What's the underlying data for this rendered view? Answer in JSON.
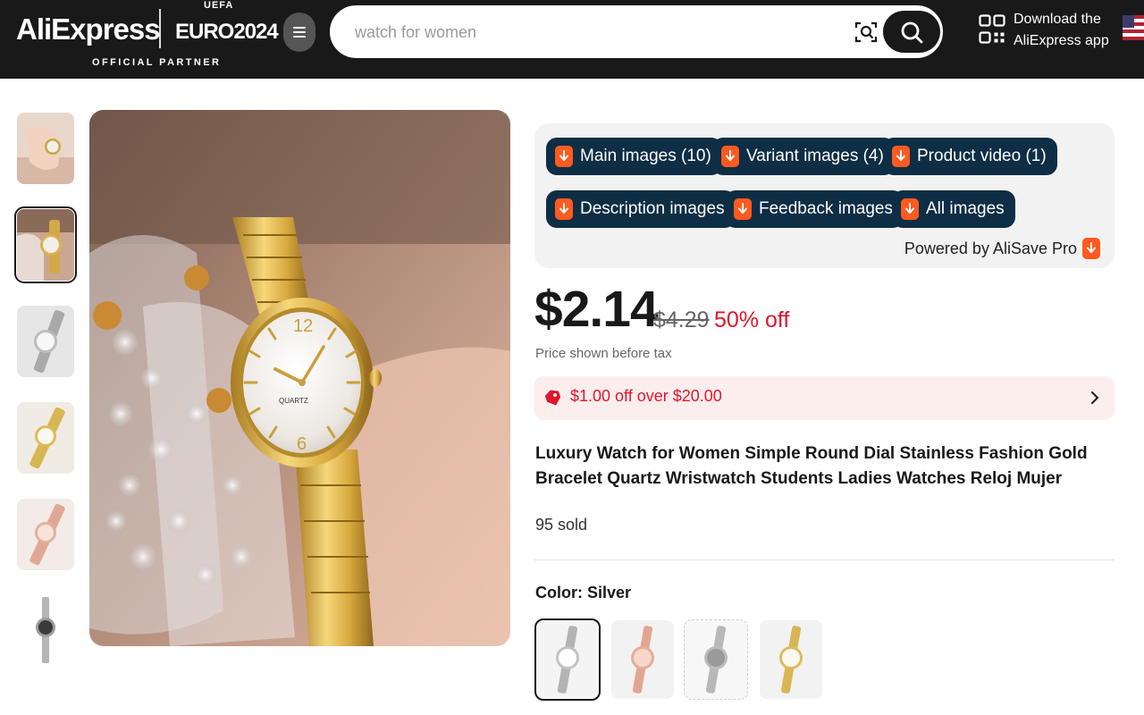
{
  "header": {
    "logo": "AliExpress",
    "euro_small": "UEFA",
    "euro_text": "EURO2024",
    "partner": "OFFICIAL PARTNER",
    "search_placeholder": "watch for women",
    "app_line1": "Download the",
    "app_line2": "AliExpress app"
  },
  "alisave": {
    "buttons": [
      "Main images (10)",
      "Variant images (4)",
      "Product video (1)",
      "Description images",
      "Feedback images",
      "All images"
    ],
    "powered_by": "Powered by AliSave Pro",
    "button_color": "#0e2e45",
    "badge_color": "#ff5a1f"
  },
  "product": {
    "price": "$2.14",
    "original_price": "$4.29",
    "discount": "50% off",
    "tax_note": "Price shown before tax",
    "coupon": "$1.00 off over $20.00",
    "title": "Luxury Watch for Women Simple Round Dial Stainless Fashion Gold Bracelet Quartz Wristwatch Students Ladies Watches Reloj Mujer",
    "sold": "95 sold",
    "color_label": "Color: Silver",
    "colors": [
      "Silver",
      "Rose gold",
      "Silver",
      "Gold"
    ]
  },
  "main_image": {
    "dial_text": "QUARTZ",
    "dial_numbers": [
      "12",
      "6"
    ]
  },
  "colors": {
    "accent_red": "#e0162b",
    "header_bg": "#191919"
  }
}
